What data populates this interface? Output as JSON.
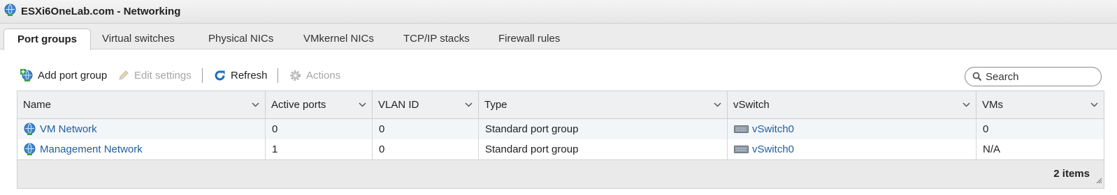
{
  "window": {
    "title": "ESXi6OneLab.com - Networking"
  },
  "tabs": [
    {
      "label": "Port groups",
      "active": true
    },
    {
      "label": "Virtual switches"
    },
    {
      "label": "Physical NICs"
    },
    {
      "label": "VMkernel NICs"
    },
    {
      "label": "TCP/IP stacks"
    },
    {
      "label": "Firewall rules"
    }
  ],
  "toolbar": {
    "add_label": "Add port group",
    "edit_label": "Edit settings",
    "refresh_label": "Refresh",
    "actions_label": "Actions",
    "search_placeholder": "Search"
  },
  "table": {
    "columns": [
      "Name",
      "Active ports",
      "VLAN ID",
      "Type",
      "vSwitch",
      "VMs"
    ],
    "rows": [
      {
        "name": "VM Network",
        "active_ports": "0",
        "vlan_id": "0",
        "type": "Standard port group",
        "vswitch": "vSwitch0",
        "vms": "0"
      },
      {
        "name": "Management Network",
        "active_ports": "1",
        "vlan_id": "0",
        "type": "Standard port group",
        "vswitch": "vSwitch0",
        "vms": "N/A"
      }
    ],
    "footer": "2 items"
  },
  "colors": {
    "link": "#1f5f9e",
    "disabled": "#a6a6a6",
    "header_bg": "#eef0f1",
    "refresh_blue": "#1a6fc4"
  }
}
